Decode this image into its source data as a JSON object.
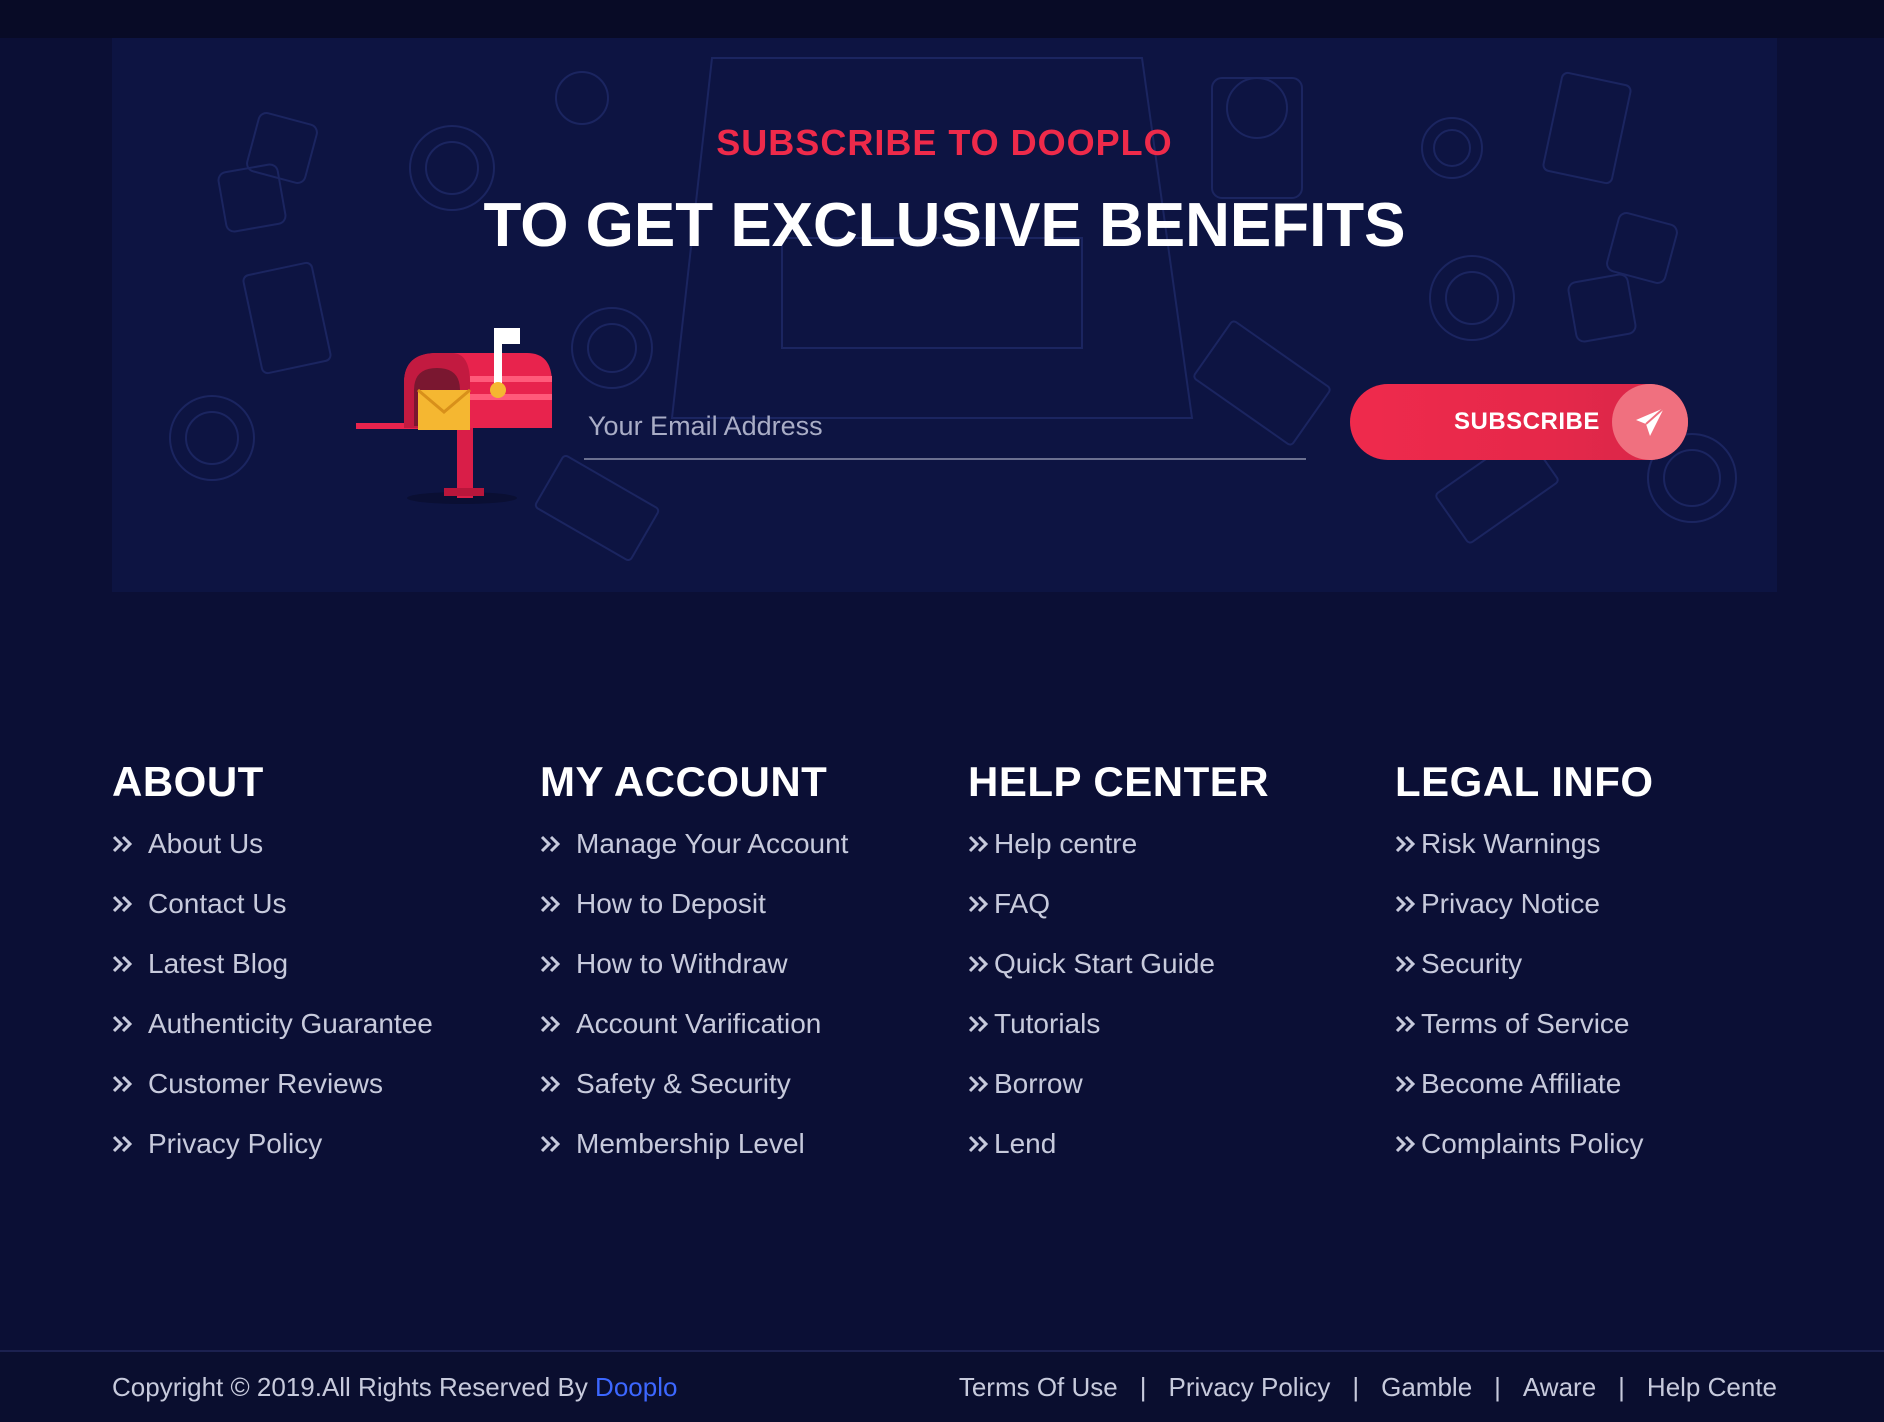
{
  "subscribe": {
    "kicker": "SUBSCRIBE TO DOOPLO",
    "title": "TO GET EXCLUSIVE BENEFITS",
    "email_placeholder": "Your Email Address",
    "button_label": "SUBSCRIBE",
    "button_icon": "paper-plane-icon",
    "illustration": "mailbox-icon"
  },
  "footer": {
    "columns": [
      {
        "heading": "ABOUT",
        "links": [
          "About Us",
          "Contact Us",
          "Latest Blog",
          "Authenticity Guarantee",
          "Customer Reviews",
          "Privacy Policy"
        ]
      },
      {
        "heading": "MY ACCOUNT",
        "links": [
          "Manage Your Account",
          "How to Deposit",
          "How to Withdraw",
          "Account Varification",
          "Safety & Security",
          "Membership Level"
        ]
      },
      {
        "heading": "HELP CENTER",
        "links": [
          "Help centre",
          "FAQ",
          "Quick Start Guide",
          "Tutorials",
          "Borrow",
          "Lend"
        ]
      },
      {
        "heading": "LEGAL INFO",
        "links": [
          "Risk Warnings",
          "Privacy Notice",
          "Security",
          "Terms of Service",
          "Become Affiliate",
          "Complaints Policy"
        ]
      }
    ],
    "link_icon": "double-chevron-right-icon"
  },
  "bottom": {
    "copyright_text": "Copyright © 2019.All Rights Reserved By ",
    "brand_link": "Dooplo",
    "links": [
      "Terms Of Use",
      "Privacy Policy",
      "Gamble",
      "Aware",
      "Help Cente"
    ],
    "separator": "|"
  },
  "colors": {
    "background": "#0b0f35",
    "panel": "#0d1442",
    "accent_red": "#ee2a4a",
    "link_blue": "#3c67ff",
    "text_muted": "#c7cadc"
  }
}
